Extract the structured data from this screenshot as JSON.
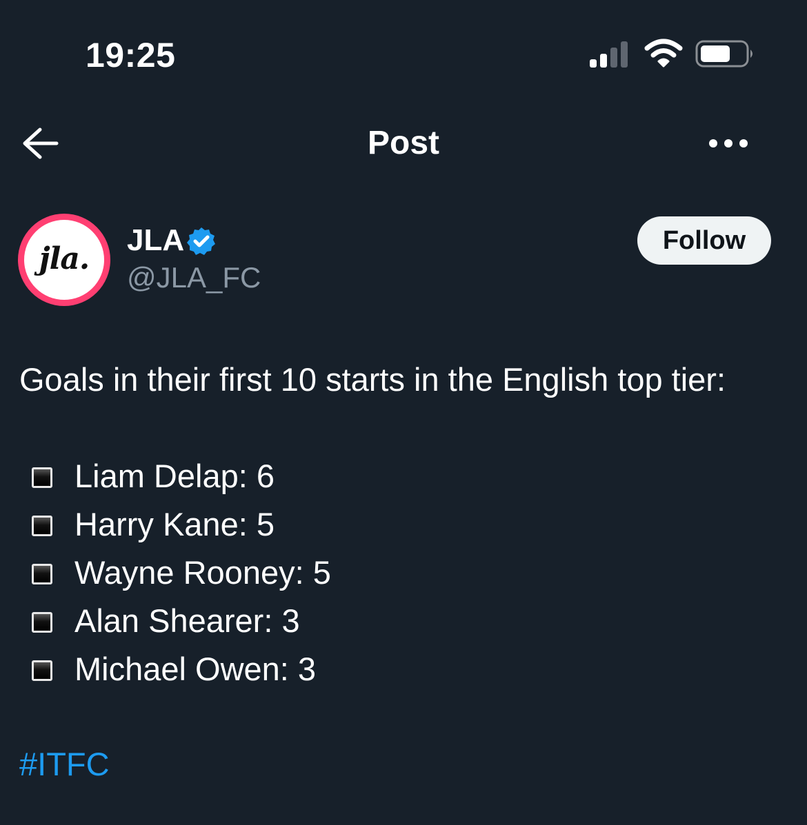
{
  "status_bar": {
    "time": "19:25",
    "signal_icon": "cellular-signal-icon",
    "wifi_icon": "wifi-icon",
    "battery_icon": "battery-icon"
  },
  "nav": {
    "back_icon": "arrow-left-icon",
    "title": "Post",
    "more_icon": "more-horizontal-icon"
  },
  "author": {
    "avatar_text": "jla.",
    "display_name": "JLA",
    "verified_icon": "verified-badge-icon",
    "handle": "@JLA_FC",
    "follow_label": "Follow",
    "avatar_ring_color": "#ff3f72",
    "verified_color": "#1d9bf0"
  },
  "post": {
    "intro": "Goals in their first 10 starts in the English top tier:",
    "bullet_icon": "black-square-icon",
    "items": [
      "Liam Delap: 6",
      "Harry Kane: 5",
      "Wayne Rooney: 5",
      "Alan Shearer: 3",
      "Michael Owen: 3"
    ],
    "hashtag": "#ITFC",
    "hashtag_color": "#1d9bf0"
  },
  "theme": {
    "background": "#17202a",
    "text": "#ffffff",
    "muted_text": "#8b98a5"
  }
}
